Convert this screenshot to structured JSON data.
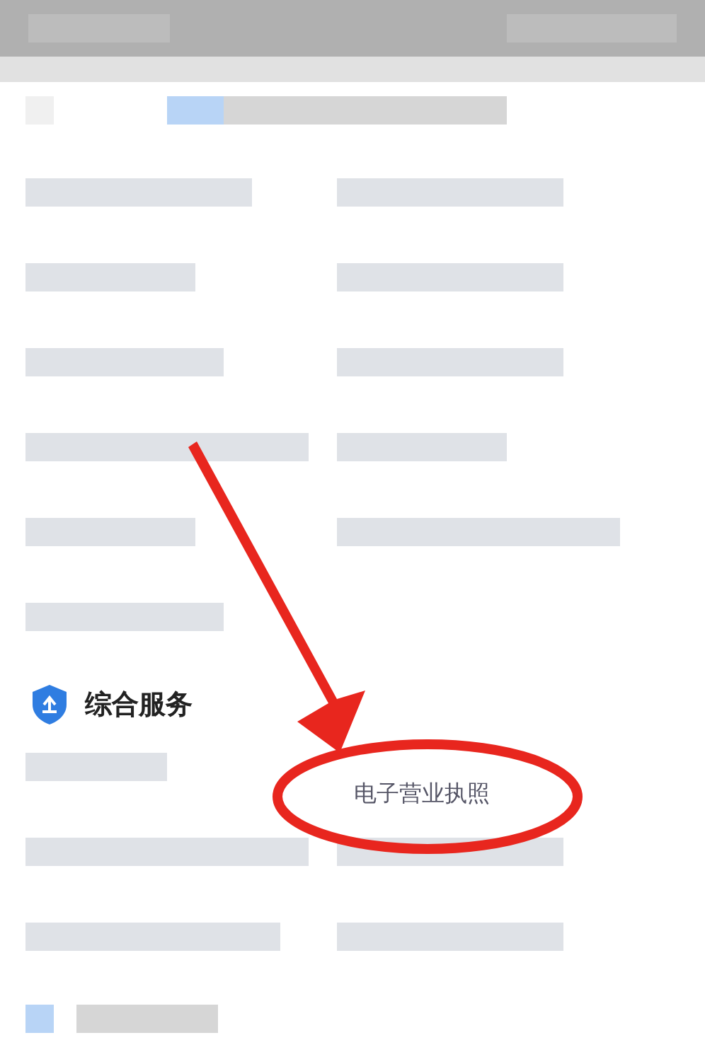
{
  "section": {
    "title": "综合服务",
    "items": [
      {
        "label": "电子营业执照",
        "highlighted": true
      }
    ]
  }
}
